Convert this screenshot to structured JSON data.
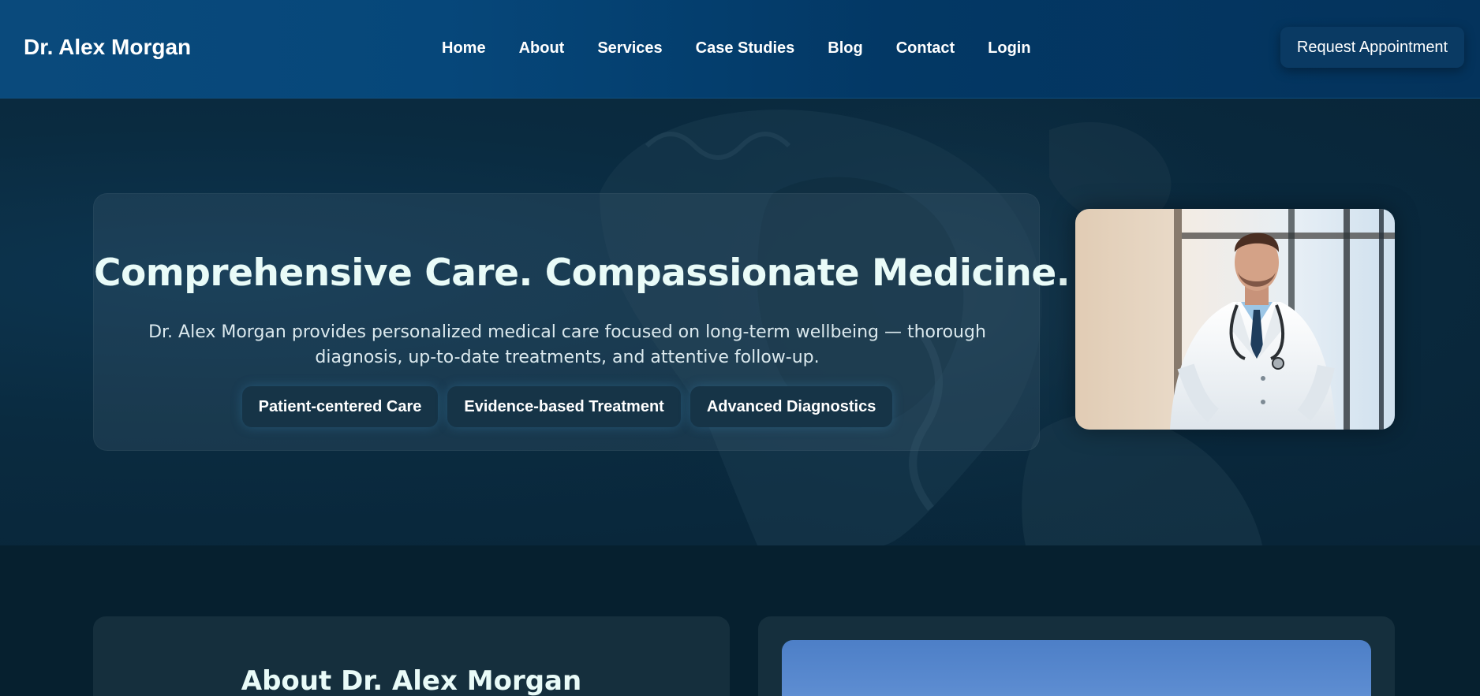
{
  "header": {
    "brand": "Dr. Alex Morgan",
    "nav": [
      "Home",
      "About",
      "Services",
      "Case Studies",
      "Blog",
      "Contact",
      "Login"
    ],
    "cta_label": "Request Appointment"
  },
  "hero": {
    "title": "Comprehensive Care. Compassionate Medicine.",
    "subtitle": "Dr. Alex Morgan provides personalized medical care focused on long-term wellbeing — thorough diagnosis, up-to-date treatments, and attentive follow-up.",
    "chips": [
      "Patient-centered Care",
      "Evidence-based Treatment",
      "Advanced Diagnostics"
    ]
  },
  "about": {
    "title": "About Dr. Alex Morgan"
  },
  "colors": {
    "header_bg": "#06477a",
    "page_bg": "#06202f",
    "title_text": "#e9fbf8",
    "chip_bg": "#163447"
  }
}
